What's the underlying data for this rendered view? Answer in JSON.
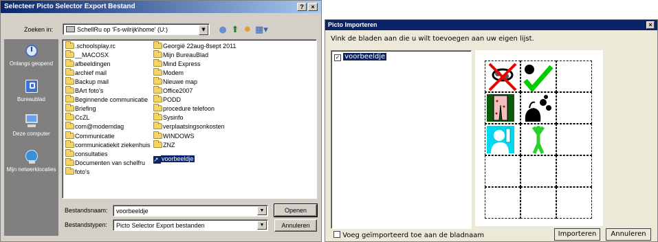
{
  "export_dialog": {
    "title": "Selecteer Picto Selector Export Bestand",
    "help_label": "?",
    "close_label": "×",
    "look_in_label": "Zoeken in:",
    "look_in_value": "SchellRu op 'Fs-wilrijk\\home' (U:)",
    "places": [
      {
        "label": "Onlangs geopend",
        "icon": "recent-icon"
      },
      {
        "label": "Bureaublad",
        "icon": "desktop-icon"
      },
      {
        "label": "Deze computer",
        "icon": "my-computer-icon"
      },
      {
        "label": "Mijn netwerklocaties",
        "icon": "network-icon"
      }
    ],
    "files_col1": [
      ".schoolsplay.rc",
      "__MACOSX",
      "afbeeldingen",
      "archief mail",
      "Backup mail",
      "BArt foto's",
      "Beginnende communicatie",
      "Briefing",
      "CcZL",
      "com@modemdag",
      "Communicatie",
      "communicatiekit ziekenhuis",
      "consultaties",
      "Documenten van schelfru",
      "foto's"
    ],
    "files_col2": [
      "Georgië 22aug-8sept 2011",
      "Mijn BureauBlad",
      "Mind Express",
      "Modem",
      "Nieuwe map",
      "Office2007",
      "PODD",
      "procedure telefoon",
      "Sysinfo",
      "verplaatsingsonkosten",
      "WINDOWS",
      "ZNZ"
    ],
    "selected_file": "voorbeeldje",
    "filename_label": "Bestandsnaam:",
    "filename_value": "voorbeeldje",
    "filetype_label": "Bestandstypen:",
    "filetype_value": "Picto Selector Export bestanden",
    "open_label": "Openen",
    "cancel_label": "Annuleren"
  },
  "import_dialog": {
    "title": "Picto Importeren",
    "close_label": "×",
    "instruction": "Vink de bladen aan die u wilt toevoegen aan uw eigen lijst.",
    "sheets": [
      {
        "label": "voorbeeldje",
        "checked": true
      }
    ],
    "add_to_tab_label": "Voeg geïmporteerd toe aan de bladnaam",
    "add_to_tab_checked": false,
    "import_label": "Importeren",
    "cancel_label": "Annuleren"
  },
  "colors": {
    "titlebar": "#0a246a",
    "selection": "#0a246a",
    "dialog_bg": "#d4d0c8",
    "places_bg": "#808080"
  }
}
